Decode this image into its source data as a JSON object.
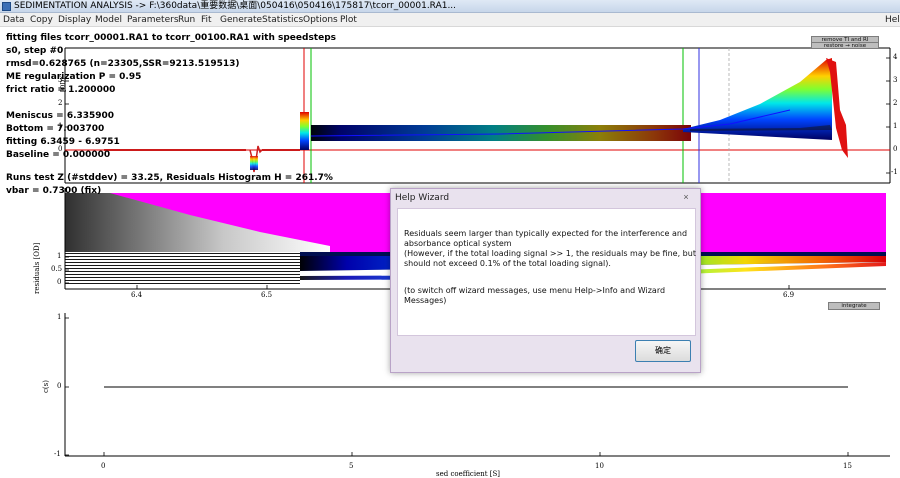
{
  "window": {
    "title": "SEDIMENTATION ANALYSIS -> F:\\360data\\重要数据\\桌面\\050416\\050416\\175817\\tcorr_00001.RA1...",
    "icon": "app-icon"
  },
  "menu": {
    "items": [
      "Data",
      "Copy",
      "Display",
      "Model",
      "Parameters",
      "Run",
      "Fit",
      "Generate",
      "Statistics",
      "Options",
      "Plot"
    ],
    "help_label": "Hel"
  },
  "fit_info": {
    "line1": "fitting files tcorr_00001.RA1 to tcorr_00100.RA1 with speedsteps",
    "line2": "s0, step #0",
    "line3": "rmsd=0.628765 (n=23305,SSR=9213.519513)",
    "line4": "ME regularization P = 0.95",
    "line5": "frict ratio = 1.200000",
    "line6": "Meniscus = 6.335900",
    "line7": "Bottom = 7.003700",
    "line8": "fitting 6.3459 - 6.9751",
    "line9": "Baseline = 0.000000",
    "line10": "Runs test Z (#stddev) = 33.25, Residuals Histogram H = 261.7%",
    "line11": "vbar = 0.7300 (fix)"
  },
  "top_buttons": {
    "remove_label": "remove TI and RI",
    "noise_label": "restore → noise"
  },
  "plot1": {
    "right_ticks": [
      "4",
      "3",
      "2",
      "1",
      "0",
      "-1"
    ],
    "left_ticks": [
      "3",
      "2",
      "1",
      "0"
    ],
    "left_ylabel": "[OD]"
  },
  "plot2": {
    "ylabel": "residuals [OD]",
    "yticks": [
      "1",
      "0.5",
      "0"
    ],
    "xticks": [
      "6.4",
      "6.5",
      "6.9"
    ]
  },
  "integrate_label": "integrate",
  "plot3": {
    "ylabel": "c(s)",
    "yticks": [
      "1",
      "0",
      "-1"
    ],
    "xticks": [
      "0",
      "5",
      "10",
      "15"
    ],
    "xlabel": "sed coefficient [S]"
  },
  "dialog": {
    "title": "Help Wizard",
    "close_glyph": "×",
    "lines": [
      "Residuals seem larger than typically expected for the interference and",
      "absorbance optical system",
      "(However, if the total loading signal >> 1, the residuals may be fine, but",
      "should not exceed 0.1% of the total loading signal).",
      "(to switch off wizard messages, use menu Help->Info and Wizard",
      "Messages)"
    ],
    "ok_label": "确定"
  }
}
